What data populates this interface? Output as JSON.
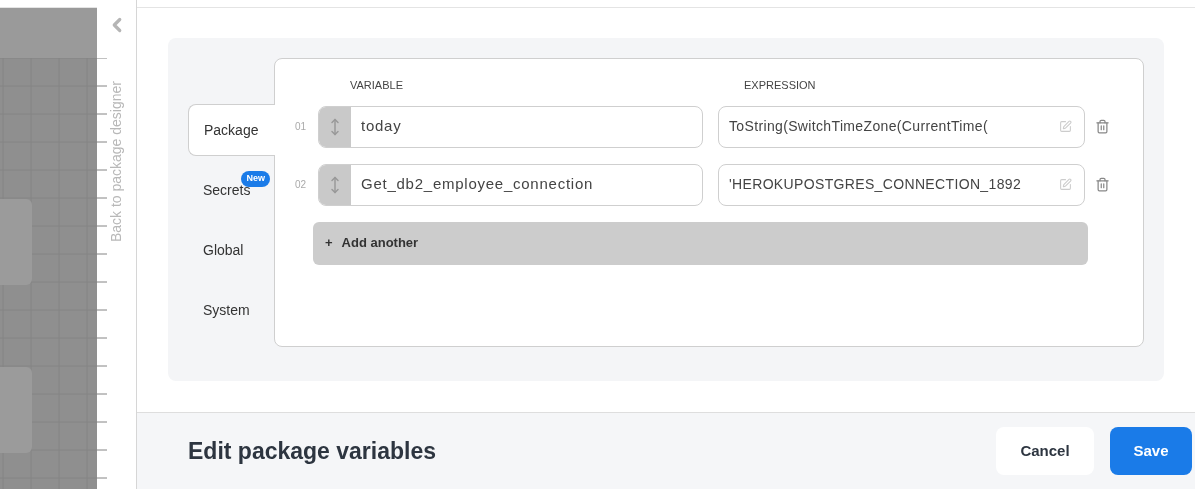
{
  "side_rail": {
    "label": "Back to package designer"
  },
  "tabs": [
    {
      "label": "Package",
      "selected": true
    },
    {
      "label": "Secrets",
      "selected": false,
      "badge": "New"
    },
    {
      "label": "Global",
      "selected": false
    },
    {
      "label": "System",
      "selected": false
    }
  ],
  "columns": {
    "variable": "VARIABLE",
    "expression": "EXPRESSION"
  },
  "rows": [
    {
      "number": "01",
      "variable": "today",
      "expression": "ToString(SwitchTimeZone(CurrentTime("
    },
    {
      "number": "02",
      "variable": "Get_db2_employee_connection",
      "expression": "'HEROKUPOSTGRES_CONNECTION_1892"
    }
  ],
  "add_button": {
    "icon": "+",
    "label": "Add another"
  },
  "footer": {
    "title": "Edit package variables",
    "buttons": [
      {
        "kind": "secondary",
        "label": "Cancel"
      },
      {
        "kind": "primary",
        "label": "Save"
      }
    ]
  }
}
